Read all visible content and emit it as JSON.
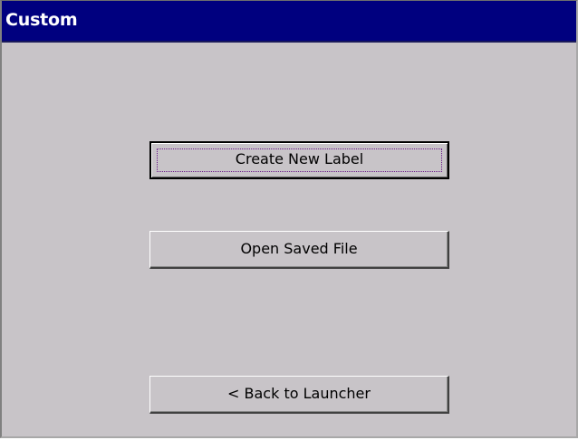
{
  "window": {
    "title": "Custom"
  },
  "buttons": {
    "create_new_label": "Create New Label",
    "open_saved_file": "Open Saved File",
    "back_to_launcher": "< Back to Launcher"
  }
}
